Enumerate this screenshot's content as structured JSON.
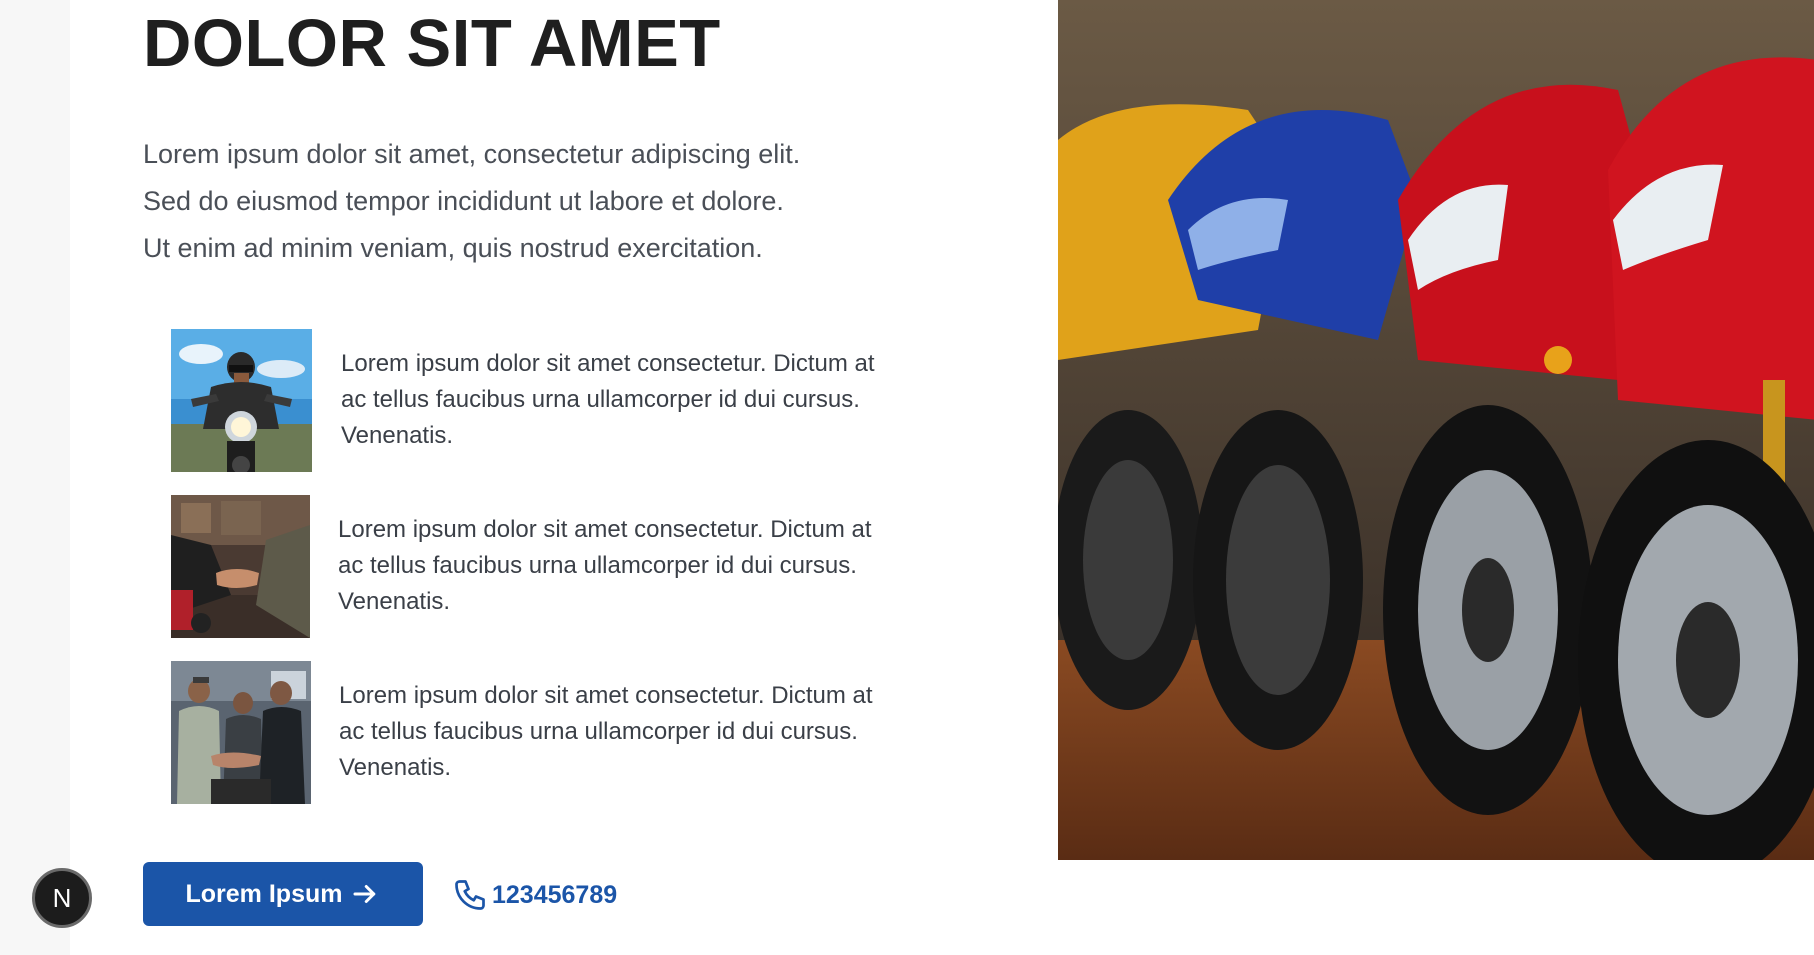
{
  "heading": "DOLOR SIT AMET",
  "intro": [
    "Lorem ipsum dolor sit amet, consectetur adipiscing elit.",
    "Sed do eiusmod tempor incididunt ut labore et dolore.",
    "Ut enim ad minim veniam, quis nostrud exercitation."
  ],
  "features": [
    {
      "text": "Lorem ipsum dolor sit amet consectetur. Dictum at ac tellus faucibus urna ullamcorper id dui cursus. Venenatis."
    },
    {
      "text": "Lorem ipsum dolor sit amet consectetur. Dictum at ac tellus faucibus urna ullamcorper id dui cursus. Venenatis."
    },
    {
      "text": "Lorem ipsum dolor sit amet consectetur. Dictum at ac tellus faucibus urna ullamcorper id dui cursus. Venenatis."
    }
  ],
  "cta": {
    "label": "Lorem Ipsum",
    "icon": "arrow-right-icon"
  },
  "phone": {
    "number": "123456789",
    "icon": "phone-icon"
  },
  "badge": {
    "letter": "N"
  },
  "colors": {
    "accent": "#1b55a8",
    "heading": "#1f1f1f",
    "body_text": "#4a4f57"
  }
}
